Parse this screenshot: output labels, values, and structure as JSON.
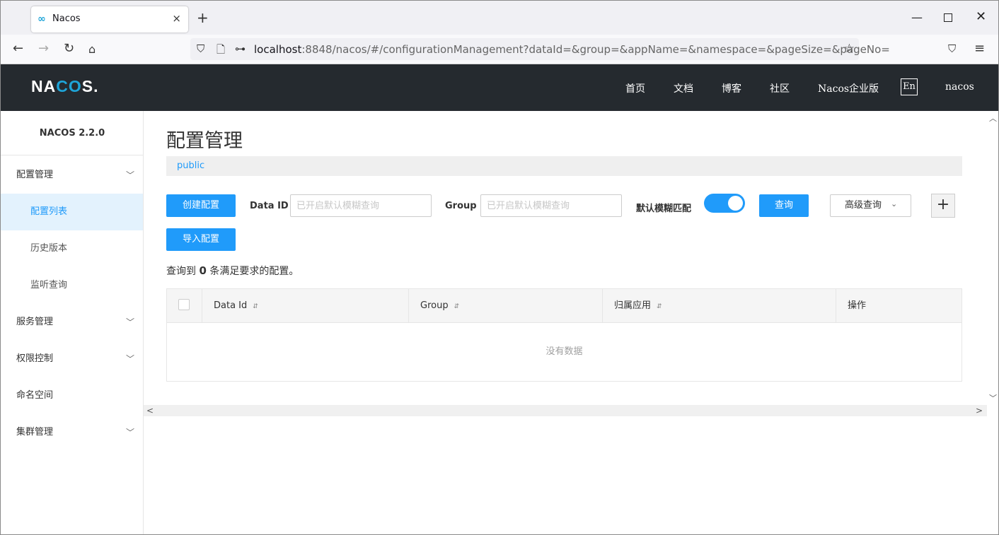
{
  "browser": {
    "tab_title": "Nacos",
    "tab_favicon": "∞",
    "close_glyph": "×",
    "newtab_glyph": "+",
    "url_host": "localhost",
    "url_rest": ":8848/nacos/#/configurationManagement?dataId=&group=&appName=&namespace=&pageSize=&pageNo=",
    "icons": [
      "back-icon",
      "forward-icon",
      "reload-icon",
      "home-icon",
      "shield-icon",
      "page-icon",
      "key-icon",
      "star-icon",
      "pocket-icon",
      "menu-icon",
      "minimize-icon",
      "maximize-icon",
      "close-icon"
    ]
  },
  "header": {
    "logo_prefix": "NA",
    "logo_oo": "CO",
    "logo_suffix": "S.",
    "nav": [
      "首页",
      "文档",
      "博客",
      "社区",
      "Nacos企业版"
    ],
    "lang": "En",
    "user": "nacos"
  },
  "sidebar": {
    "version": "NACOS 2.2.0",
    "menu": {
      "config": "配置管理",
      "config_list": "配置列表",
      "history": "历史版本",
      "listener": "监听查询",
      "service": "服务管理",
      "auth": "权限控制",
      "namespace": "命名空间",
      "cluster": "集群管理"
    },
    "chevron": "﹀"
  },
  "main": {
    "title": "配置管理",
    "namespace": "public",
    "create_btn": "创建配置",
    "dataid_label": "Data ID",
    "dataid_placeholder": "已开启默认模糊查询",
    "group_label": "Group",
    "group_placeholder": "已开启默认模糊查询",
    "fuzzy_label": "默认模糊匹配",
    "fuzzy_on": true,
    "query_btn": "查询",
    "advanced_btn": "高级查询",
    "advanced_caret": "⌄",
    "plus": "+",
    "import_btn": "导入配置",
    "result_prefix": "查询到",
    "result_count": "0",
    "result_suffix": "条满足要求的配置。",
    "table": {
      "columns": [
        "Data Id",
        "Group",
        "归属应用",
        "操作"
      ],
      "sort_glyph": "⇵",
      "empty": "没有数据"
    }
  },
  "colors": {
    "header_bg": "#252a2f",
    "accent": "#209bfa",
    "logo_accent": "#1ea4d8"
  }
}
